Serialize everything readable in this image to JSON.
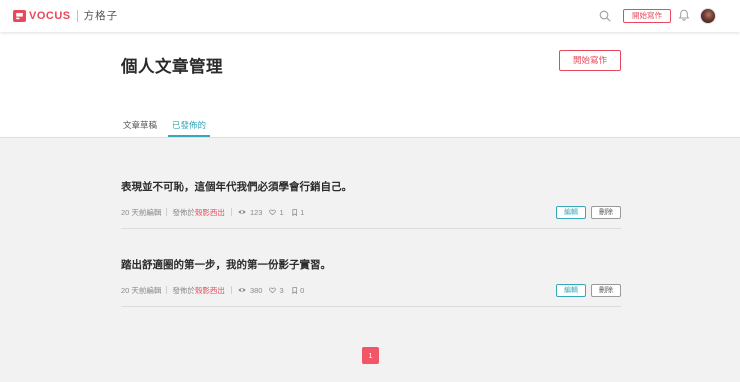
{
  "header": {
    "logo_text": "VOCUS",
    "logo_sub": "方格子",
    "write_button_label": "開始寫作"
  },
  "page": {
    "title": "個人文章管理",
    "write_button_label": "開始寫作",
    "tabs": [
      {
        "label": "文章草稿",
        "active": false
      },
      {
        "label": "已發佈的",
        "active": true
      }
    ]
  },
  "articles": [
    {
      "title": "表現並不可恥，這個年代我們必須學會行銷自己。",
      "edited": "20 天前編輯",
      "published_prefix": "發佈於",
      "salon": "殼影西出",
      "views": "123",
      "likes": "1",
      "bookmarks": "1",
      "edit_label": "編輯",
      "delete_label": "刪除"
    },
    {
      "title": "踏出舒適圈的第一步，我的第一份影子實習。",
      "edited": "20 天前編輯",
      "published_prefix": "發佈於",
      "salon": "殼影西出",
      "views": "380",
      "likes": "3",
      "bookmarks": "0",
      "edit_label": "編輯",
      "delete_label": "刪除"
    }
  ],
  "pagination": {
    "current_page": "1"
  },
  "icons": {
    "header": [
      "logo-icon",
      "search-icon",
      "bell-icon"
    ],
    "stats": [
      "eye-icon",
      "heart-icon",
      "bookmark-icon"
    ]
  },
  "colors": {
    "brand_red": "#e8495b",
    "accent_teal": "#3aa6b9",
    "background": "#f2f2f2",
    "pagination_active": "#f25566"
  }
}
